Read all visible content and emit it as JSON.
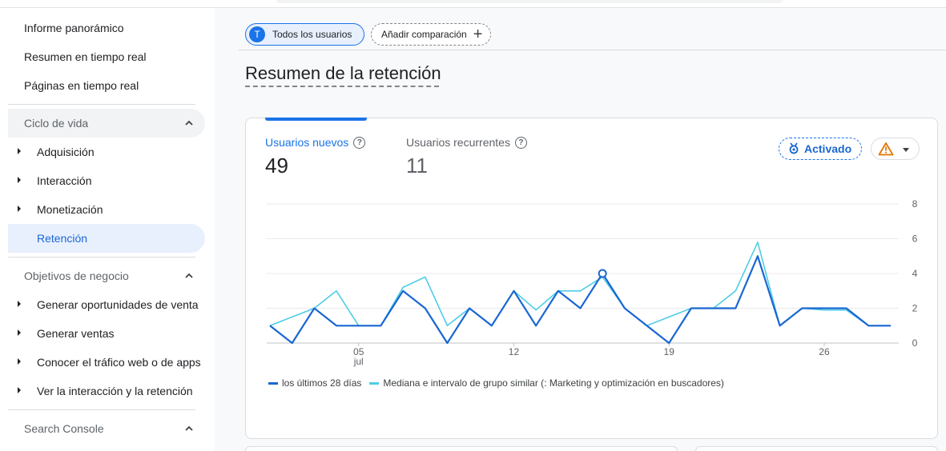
{
  "sidebar": {
    "top_items": [
      {
        "label": "Informe panorámico"
      },
      {
        "label": "Resumen en tiempo real"
      },
      {
        "label": "Páginas en tiempo real"
      }
    ],
    "sections": [
      {
        "label": "Ciclo de vida",
        "expanded": true,
        "items": [
          {
            "label": "Adquisición"
          },
          {
            "label": "Interacción"
          },
          {
            "label": "Monetización"
          },
          {
            "label": "Retención",
            "active": true
          }
        ]
      },
      {
        "label": "Objetivos de negocio",
        "expanded": true,
        "items": [
          {
            "label": "Generar oportunidades de venta"
          },
          {
            "label": "Generar ventas"
          },
          {
            "label": "Conocer el tráfico web o de apps"
          },
          {
            "label": "Ver la interacción y la retención"
          }
        ]
      },
      {
        "label": "Search Console",
        "expanded": true,
        "items": []
      }
    ]
  },
  "header": {
    "segment_chip": {
      "avatar": "T",
      "label": "Todos los usuarios"
    },
    "compare_chip": {
      "label": "Añadir comparación",
      "icon": "plus-icon"
    }
  },
  "page_title": "Resumen de la retención",
  "card": {
    "metrics": [
      {
        "label": "Usuarios nuevos",
        "value": "49",
        "selected": true
      },
      {
        "label": "Usuarios recurrentes",
        "value": "11",
        "selected": false
      }
    ],
    "insight_badge": {
      "label": "Activado",
      "icon": "ribbon-icon"
    },
    "warning_button": {
      "icon": "warning-icon"
    },
    "help_glyph": "?"
  },
  "colors": {
    "primary": "#1a73e8",
    "series_current": "#1967d2",
    "series_benchmark": "#4ecde6",
    "warning": "#e37400"
  },
  "chart_data": {
    "type": "line",
    "x": [
      "Jul 1",
      "Jul 2",
      "Jul 3",
      "Jul 4",
      "Jul 5",
      "Jul 6",
      "Jul 7",
      "Jul 8",
      "Jul 9",
      "Jul 10",
      "Jul 11",
      "Jul 12",
      "Jul 13",
      "Jul 14",
      "Jul 15",
      "Jul 16",
      "Jul 17",
      "Jul 18",
      "Jul 19",
      "Jul 20",
      "Jul 21",
      "Jul 22",
      "Jul 23",
      "Jul 24",
      "Jul 25",
      "Jul 26",
      "Jul 27",
      "Jul 28",
      "Jul 29"
    ],
    "x_ticks": [
      {
        "index": 4,
        "label": "05",
        "sublabel": "jul"
      },
      {
        "index": 11,
        "label": "12",
        "sublabel": ""
      },
      {
        "index": 18,
        "label": "19",
        "sublabel": ""
      },
      {
        "index": 25,
        "label": "26",
        "sublabel": ""
      }
    ],
    "series": [
      {
        "name": "los últimos 28 días",
        "values": [
          1,
          0,
          2,
          1,
          1,
          1,
          3,
          2,
          0,
          2,
          1,
          3,
          1,
          3,
          2,
          4,
          2,
          1,
          0,
          2,
          2,
          2,
          5,
          1,
          2,
          2,
          2,
          1,
          1
        ]
      },
      {
        "name": "Mediana e intervalo de grupo similar (: Marketing y optimización en buscadores)",
        "values": [
          1,
          1.5,
          2,
          3,
          1,
          1,
          3.2,
          3.8,
          1,
          2,
          1,
          3,
          1.9,
          3,
          3,
          3.8,
          2,
          1,
          1.5,
          2,
          2,
          3,
          5.8,
          1,
          2,
          1.9,
          1.9,
          1,
          1
        ]
      }
    ],
    "highlight_index": 15,
    "y_ticks": [
      "0",
      "2",
      "4",
      "6",
      "8"
    ],
    "ylim": [
      0,
      8
    ],
    "y_axis_side": "right",
    "grid": true,
    "legend_position": "bottom-left"
  }
}
